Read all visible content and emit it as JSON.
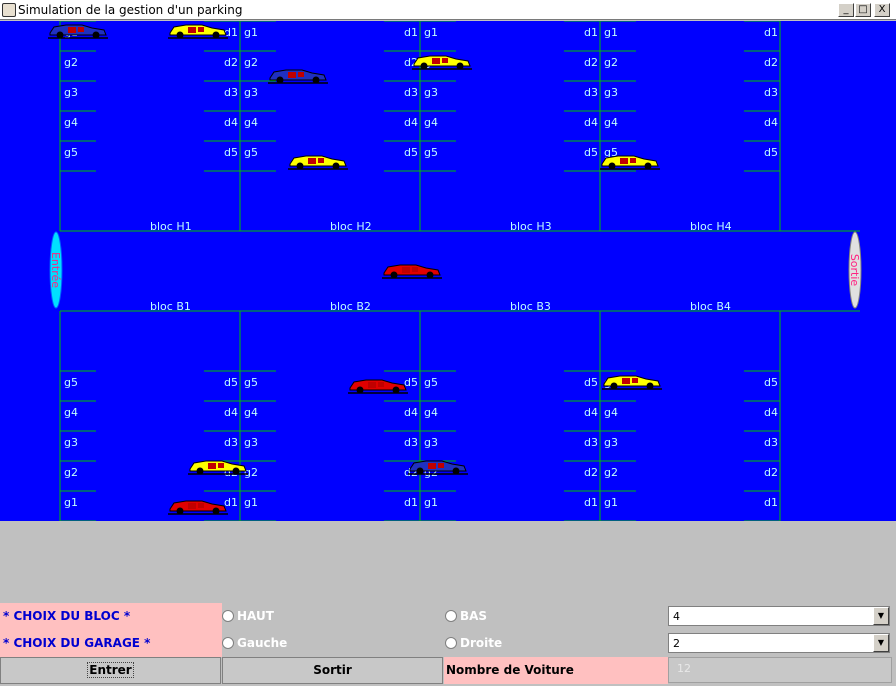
{
  "window": {
    "title": "Simulation de la gestion d'un parking",
    "minimize": "_",
    "maximize": "□",
    "close": "X"
  },
  "parking": {
    "top_blocks": [
      "bloc H1",
      "bloc H2",
      "bloc H3",
      "bloc H4"
    ],
    "bottom_blocks": [
      "bloc B1",
      "bloc B2",
      "bloc B3",
      "bloc B4"
    ],
    "entry_label": "Entrée",
    "exit_label": "Sortie",
    "left_slots_top": [
      "g1",
      "g2",
      "g3",
      "g4",
      "g5"
    ],
    "right_slots_top": [
      "d1",
      "d2",
      "d3",
      "d4",
      "d5"
    ],
    "left_slots_bottom": [
      "g5",
      "g4",
      "g3",
      "g2",
      "g1"
    ],
    "right_slots_bottom": [
      "d5",
      "d4",
      "d3",
      "d2",
      "d1"
    ]
  },
  "controls": {
    "bloc_label": "* CHOIX DU BLOC *",
    "garage_label": "* CHOIX DU GARAGE *",
    "haut": "HAUT",
    "bas": "BAS",
    "gauche": "Gauche",
    "droite": "Droite",
    "bloc_value": "4",
    "garage_value": "2",
    "enter_button": "Entrer",
    "exit_button": "Sortir",
    "count_label": "Nombre de Voiture",
    "count_value": "12"
  },
  "colors": {
    "lot_blue": "#0000ff",
    "lines_green": "#00c000",
    "label_cyan": "#c0ffff",
    "car_yellow": "#ffff00",
    "car_red": "#e00000"
  }
}
